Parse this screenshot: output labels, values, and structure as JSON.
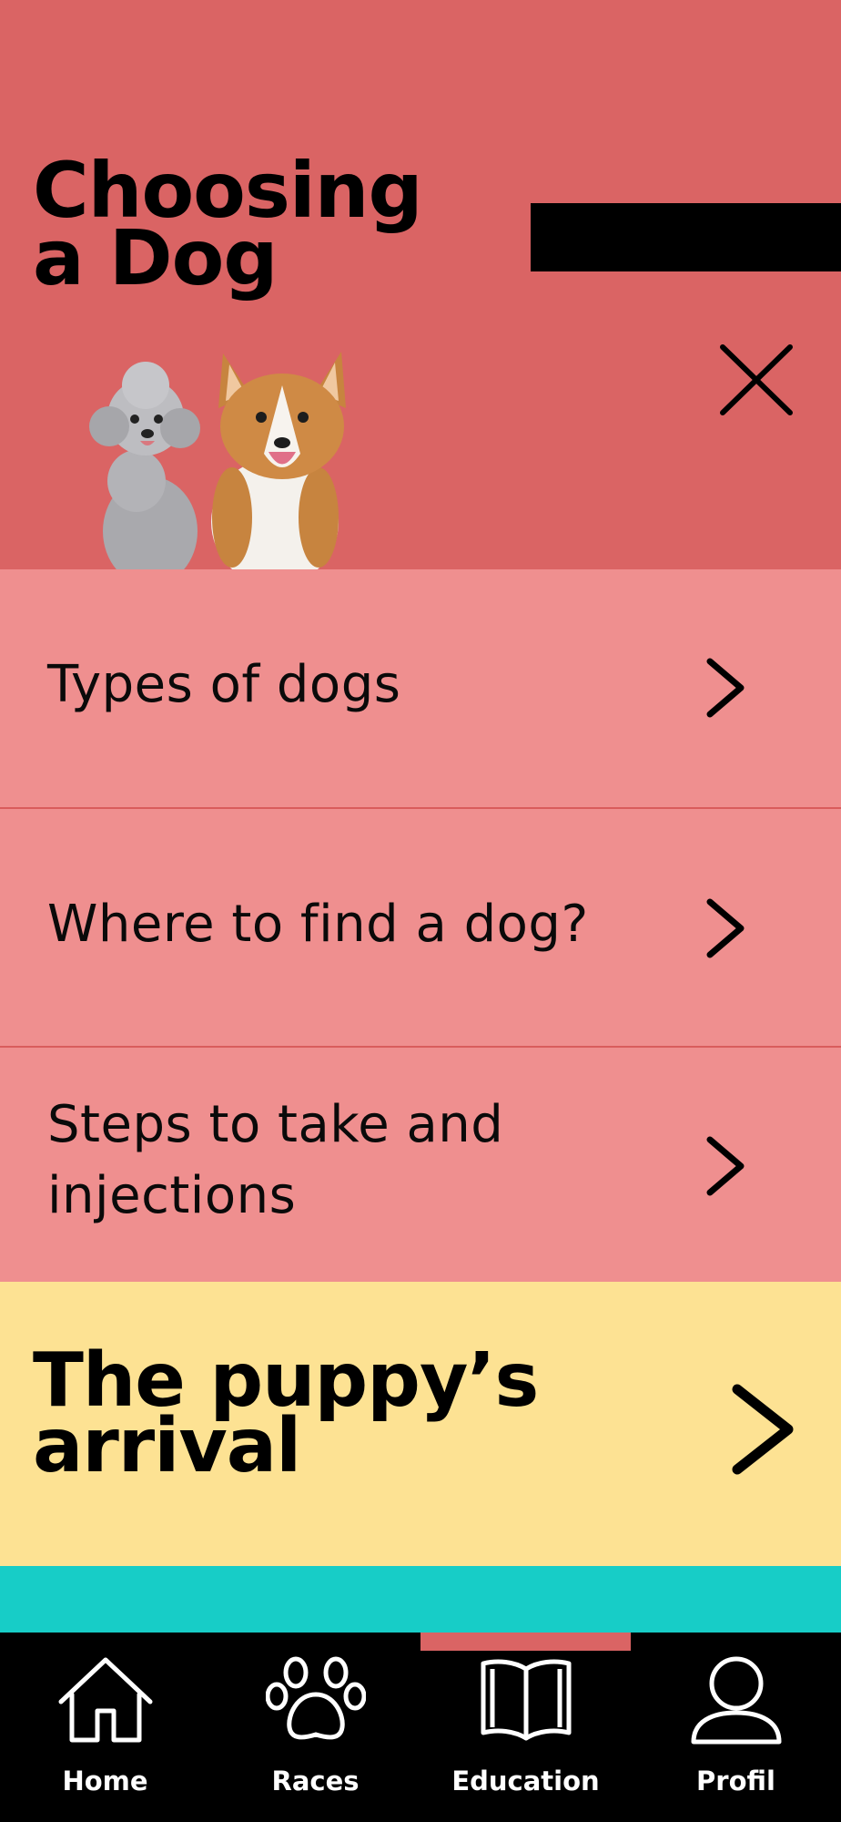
{
  "hero": {
    "title_line1": "Choosing",
    "title_line2": "a Dog"
  },
  "colors": {
    "hero_bg": "#da6464",
    "item_bg": "#ef8f8f",
    "arrival_bg": "#fde293",
    "teal": "#17cdc7",
    "nav_bg": "#000000"
  },
  "menu": {
    "items": [
      {
        "label": "Types of dogs"
      },
      {
        "label": "Where to find a dog?"
      },
      {
        "label_line1": "Steps to take and",
        "label_line2": "injections"
      }
    ]
  },
  "arrival": {
    "line1": "The puppy’s",
    "line2": "arrival"
  },
  "nav": {
    "active": "Education",
    "items": [
      {
        "label": "Home",
        "icon": "home-icon"
      },
      {
        "label": "Races",
        "icon": "paw-icon"
      },
      {
        "label": "Education",
        "icon": "book-icon"
      },
      {
        "label": "Profil",
        "icon": "user-icon"
      }
    ]
  }
}
